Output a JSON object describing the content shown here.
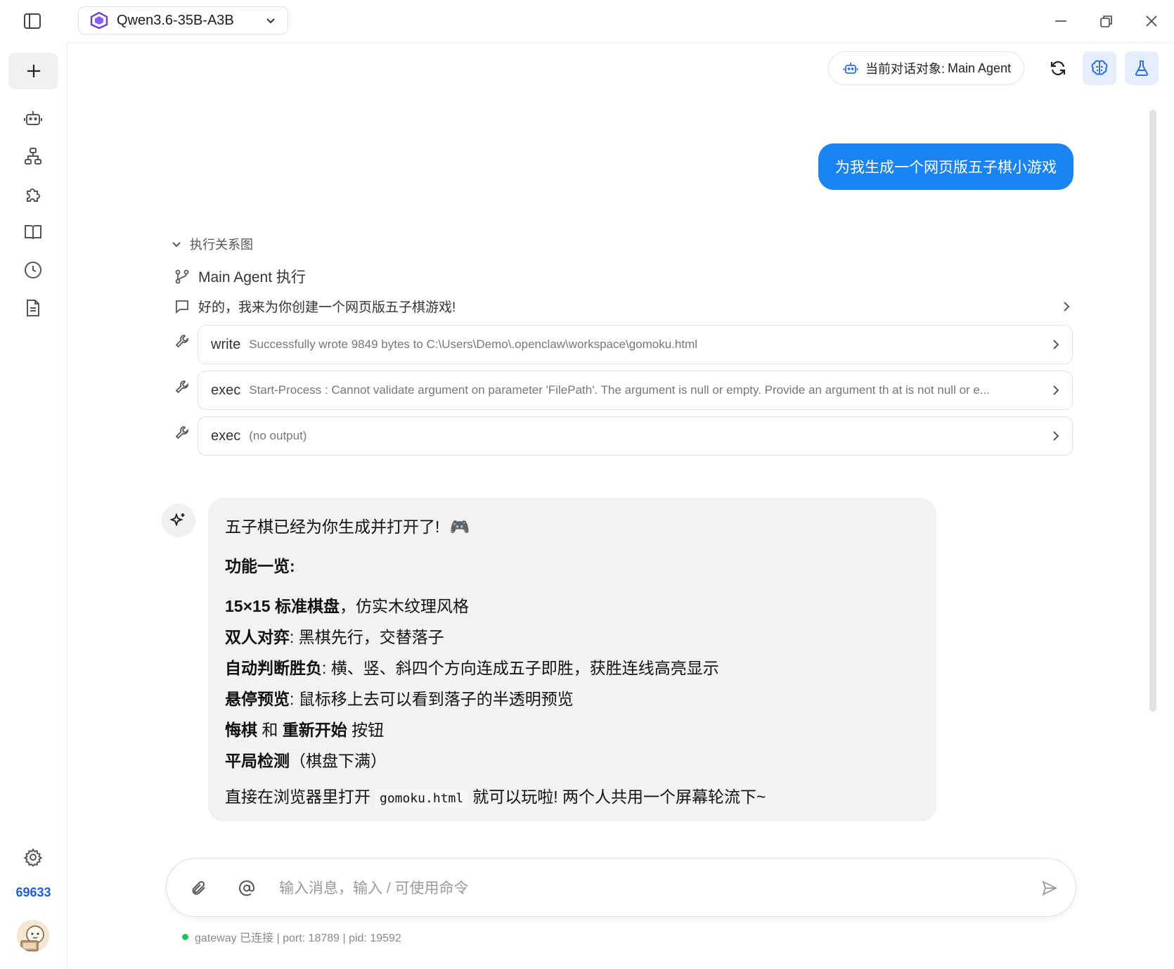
{
  "header": {
    "model_name": "Qwen3.6-35B-A3B"
  },
  "sidebar": {
    "counter": "69633",
    "items": [
      "new-chat",
      "agents",
      "org-chart",
      "plugins",
      "docs",
      "history",
      "notes"
    ]
  },
  "topbar": {
    "agent_prefix": "当前对话对象:",
    "agent_name": "Main Agent"
  },
  "chat": {
    "user_message": "为我生成一个网页版五子棋小游戏",
    "exec_toggle_label": "执行关系图",
    "exec_title": "Main Agent 执行",
    "exec_message": "好的，我来为你创建一个网页版五子棋游戏!",
    "tools": [
      {
        "name": "write",
        "output": "Successfully wrote 9849 bytes to C:\\Users\\Demo\\.openclaw\\workspace\\gomoku.html"
      },
      {
        "name": "exec",
        "output": "Start-Process : Cannot validate argument on parameter 'FilePath'. The argument is null or empty. Provide an argument th at is not null or e..."
      },
      {
        "name": "exec",
        "output": "(no output)"
      }
    ],
    "assistant": {
      "intro": "五子棋已经为你生成并打开了!",
      "intro_emoji": "🎮",
      "features_title": "功能一览:",
      "features": [
        {
          "bold": "15×15 标准棋盘",
          "rest": "，仿实木纹理风格"
        },
        {
          "bold": "双人对弈",
          "rest": ": 黑棋先行，交替落子"
        },
        {
          "bold": "自动判断胜负",
          "rest": ": 横、竖、斜四个方向连成五子即胜，获胜连线高亮显示"
        },
        {
          "bold": "悬停预览",
          "rest": ": 鼠标移上去可以看到落子的半透明预览"
        },
        {
          "bold_a": "悔棋",
          "mid": " 和 ",
          "bold_b": "重新开始",
          "rest": " 按钮"
        },
        {
          "bold": "平局检测",
          "rest": "（棋盘下满）"
        }
      ],
      "closing_before": "直接在浏览器里打开",
      "closing_code": "gomoku.html",
      "closing_after": "就可以玩啦! 两个人共用一个屏幕轮流下~"
    }
  },
  "composer": {
    "placeholder": "输入消息，输入 / 可使用命令",
    "value": ""
  },
  "status": {
    "text": "gateway 已连接 | port: 18789 | pid: 19592",
    "color": "#21c45d"
  },
  "colors": {
    "accent": "#1a84f2",
    "counter": "#1d5fd6"
  }
}
